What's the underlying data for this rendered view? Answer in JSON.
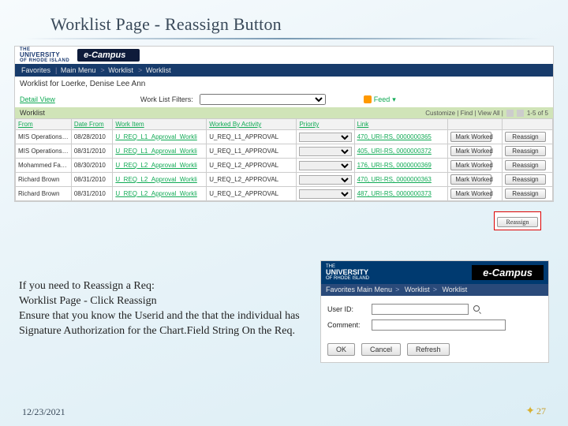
{
  "slide": {
    "title": "Worklist Page - Reassign Button",
    "date": "12/23/2021",
    "page_number": "27"
  },
  "instructions": {
    "line1": "If you need to Reassign a Req:",
    "line2": "Worklist Page - Click Reassign",
    "line3": "Ensure that you know the Userid  and the that the individual has Signature Authorization for the Chart.Field String On the Req."
  },
  "screenshot1": {
    "brand": "e-Campus",
    "uni_line1": "THE",
    "uni_line2": "UNIVERSITY",
    "uni_line3": "OF RHODE ISLAND",
    "breadcrumb": [
      "Favorites",
      "Main Menu",
      "Worklist",
      "Worklist"
    ],
    "worklist_for": "Worklist for Loerke, Denise Lee Ann",
    "detail_view": "Detail View",
    "filters_label": "Work List Filters:",
    "feed_label": "Feed",
    "grid_label": "Worklist",
    "grid_tools": "Customize | Find | View All | ",
    "grid_count": "1-5 of 5",
    "columns": [
      "From",
      "Date From",
      "Work Item",
      "Worked By Activity",
      "Priority",
      "Link",
      "",
      ""
    ],
    "buttons": {
      "mark": "Mark Worked",
      "reassign": "Reassign"
    },
    "rows": [
      {
        "from": "MIS Operations Scheduler",
        "date": "08/28/2010",
        "item": "U_REQ_L1_Approval_Workli",
        "activity": "U_REQ_L1_APPROVAL",
        "link": "470, URI-RS, 0000000365"
      },
      {
        "from": "MIS Operations Scheduler",
        "date": "08/31/2010",
        "item": "U_REQ_L1_Approval_Workli",
        "activity": "U_REQ_L1_APPROVAL",
        "link": "405, URI-RS, 0000000372"
      },
      {
        "from": "Mohammed Faghri",
        "date": "08/30/2010",
        "item": "U_REQ_L2_Approval_Workli",
        "activity": "U_REQ_L2_APPROVAL",
        "link": "176, URI-RS, 0000000369"
      },
      {
        "from": "Richard Brown",
        "date": "08/31/2010",
        "item": "U_REQ_L2_Approval_Workli",
        "activity": "U_REQ_L2_APPROVAL",
        "link": "470, URI-RS, 0000000363"
      },
      {
        "from": "Richard Brown",
        "date": "08/31/2010",
        "item": "U_REQ_L2_Approval_Workli",
        "activity": "U_REQ_L2_APPROVAL",
        "link": "487, URI-RS, 0000000373"
      }
    ]
  },
  "screenshot2": {
    "brand": "e-Campus",
    "uni_t": "THE",
    "uni_u": "UNIVERSITY",
    "uni_r": "OF RHODE ISLAND",
    "breadcrumb": [
      "Favorites",
      "Main Menu",
      "Worklist",
      "Worklist"
    ],
    "userid_label": "User ID:",
    "comment_label": "Comment:",
    "ok": "OK",
    "cancel": "Cancel",
    "refresh": "Refresh"
  }
}
